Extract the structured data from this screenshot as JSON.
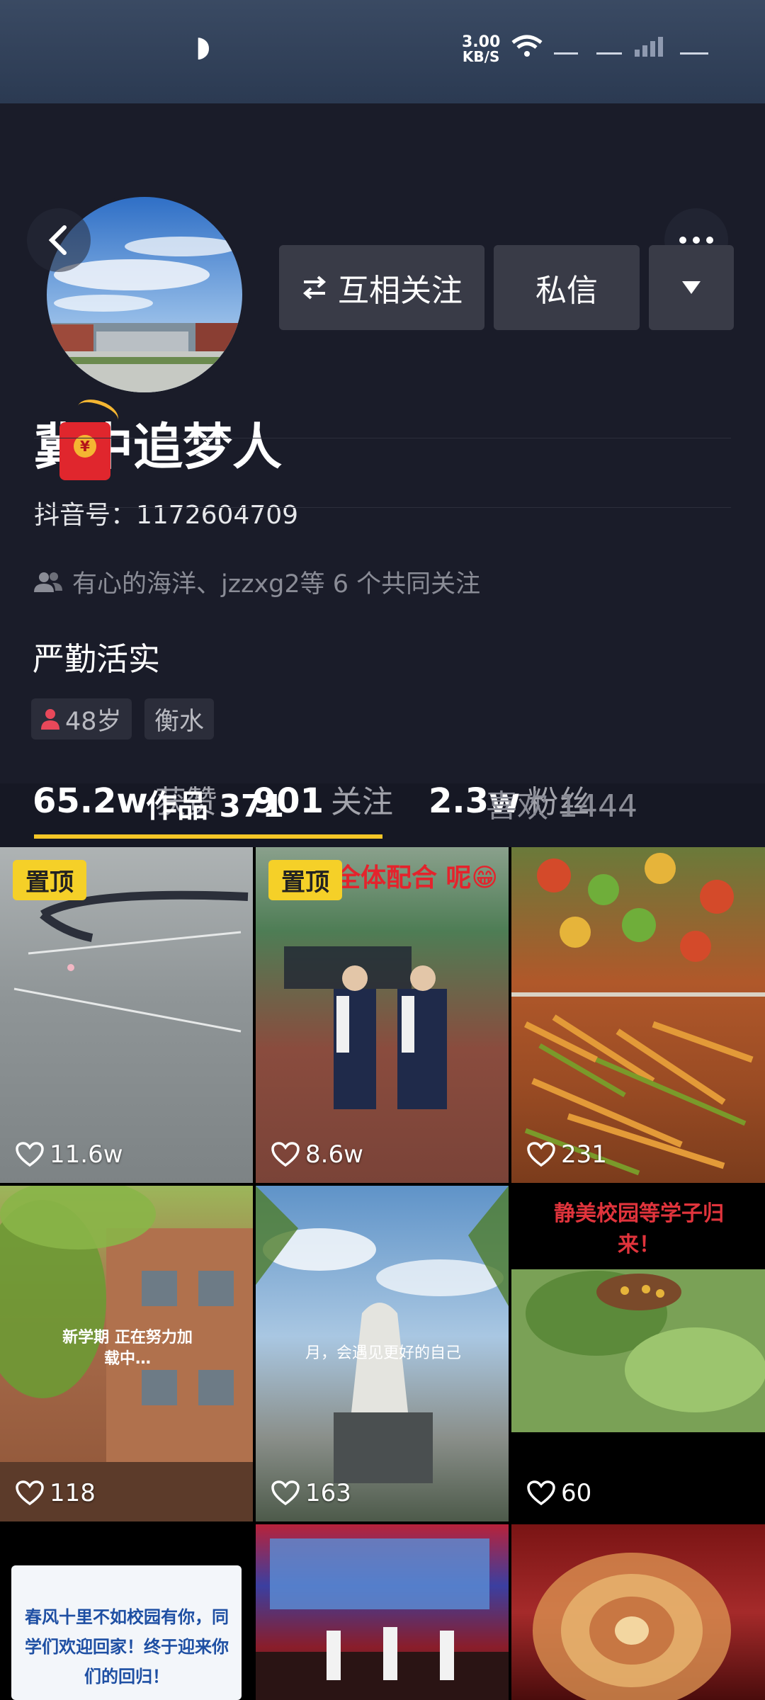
{
  "status_bar": {
    "net_speed": "3.00",
    "net_unit": "KB/S"
  },
  "header": {
    "follow_button": "互相关注",
    "message_button": "私信"
  },
  "profile": {
    "nickname_prefix": "冀",
    "nickname_partial": "中",
    "nickname_main": "追梦人",
    "douyin_id": "抖音号：1172604709",
    "mutual_follow": "有心的海洋、jzzxg2等 6 个共同关注",
    "signature": "严勤活实",
    "tags": [
      "48岁",
      "衡水"
    ],
    "stats": [
      {
        "value": "65.2w",
        "label": "获赞"
      },
      {
        "value": "901",
        "label": "关注"
      },
      {
        "value": "2.3w",
        "label": "粉丝"
      }
    ]
  },
  "tabs": [
    {
      "label": "作品 371",
      "active": true
    },
    {
      "label": "喜欢 1444",
      "active": false
    }
  ],
  "accent_color": "#f5c627",
  "videos": [
    {
      "likes": "11.6w",
      "pinned": "置顶",
      "overlay": ""
    },
    {
      "likes": "8.6w",
      "pinned": "置顶",
      "overlay": "全体配合 呢😁"
    },
    {
      "likes": "231",
      "pinned": "",
      "overlay": ""
    },
    {
      "likes": "118",
      "pinned": "",
      "overlay": "新学期 正在努力加载中…"
    },
    {
      "likes": "163",
      "pinned": "",
      "overlay": "月，会遇见更好的自己"
    },
    {
      "likes": "60",
      "pinned": "",
      "overlay": "静美校园等学子归 来！"
    },
    {
      "likes": "",
      "pinned": "",
      "overlay": "春风十里不如校园有你，同学们欢迎回家！终于迎来你们的回归！"
    },
    {
      "likes": "",
      "pinned": "",
      "overlay": ""
    },
    {
      "likes": "",
      "pinned": "",
      "overlay": ""
    }
  ]
}
